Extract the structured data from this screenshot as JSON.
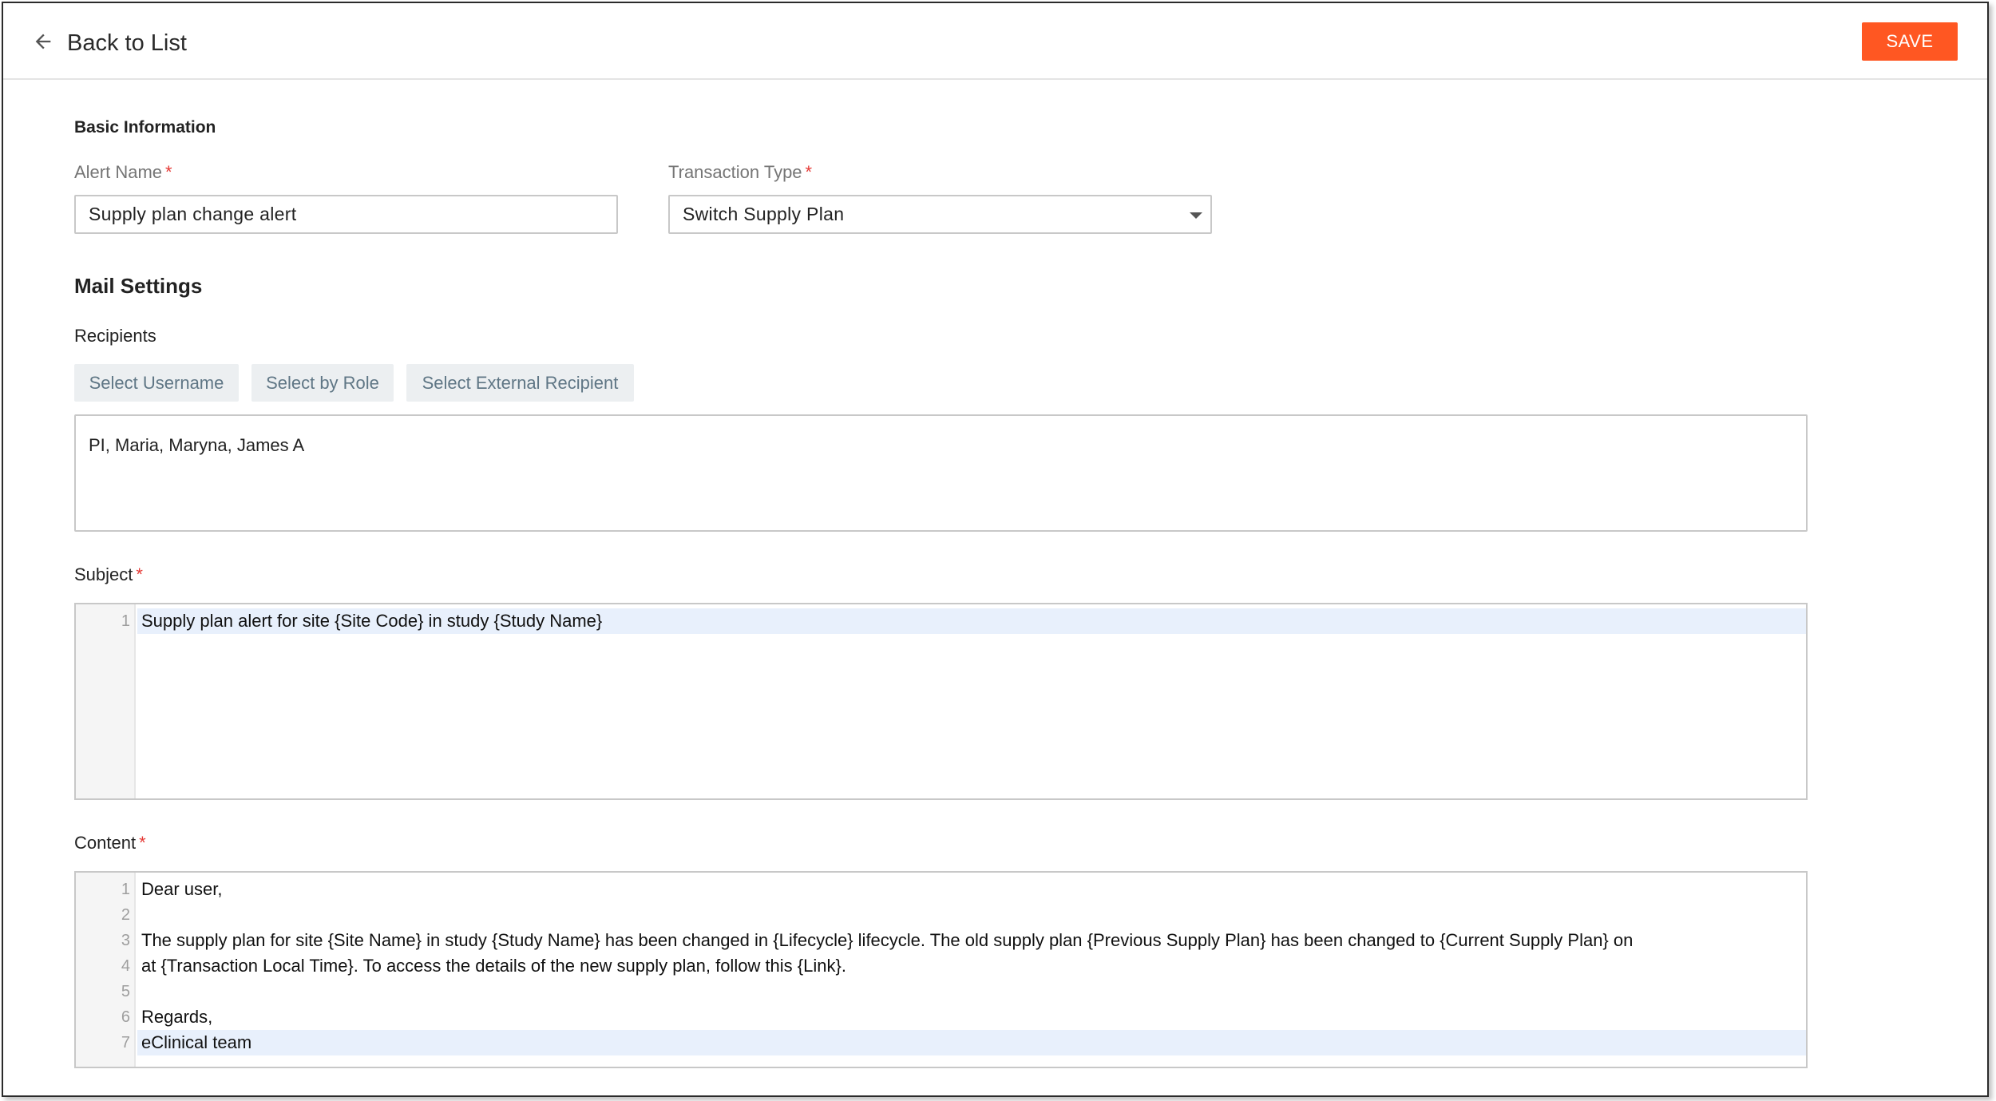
{
  "header": {
    "back_label": "Back to List",
    "save_label": "SAVE"
  },
  "basic": {
    "title": "Basic Information",
    "alert_name_label": "Alert Name",
    "alert_name_value": "Supply plan change alert",
    "transaction_type_label": "Transaction Type",
    "transaction_type_value": "Switch Supply Plan",
    "required_mark": "*"
  },
  "mail": {
    "title": "Mail Settings",
    "recipients_label": "Recipients",
    "buttons": [
      "Select Username",
      "Select by Role",
      "Select External Recipient"
    ],
    "recipients_value": "PI,  Maria,  Maryna,  James A"
  },
  "subject": {
    "label": "Subject",
    "lines": [
      {
        "num": "1",
        "text": "Supply plan alert for site {Site Code} in study {Study Name}"
      }
    ]
  },
  "content": {
    "label": "Content",
    "lines": [
      {
        "num": "1",
        "text": "Dear user,"
      },
      {
        "num": "2",
        "text": ""
      },
      {
        "num": "3",
        "text": "The supply plan for site {Site Name} in study {Study Name} has been changed in {Lifecycle} lifecycle. The old supply plan {Previous Supply Plan} has been changed to {Current Supply Plan} on"
      },
      {
        "num": "4",
        "text": "at {Transaction Local Time}. To access the details of the new supply plan, follow this {Link}."
      },
      {
        "num": "5",
        "text": ""
      },
      {
        "num": "6",
        "text": "Regards,"
      },
      {
        "num": "7",
        "text": "eClinical team"
      }
    ]
  },
  "colors": {
    "accent": "#ff5722",
    "required": "#e53935",
    "chip_bg": "#eceff1",
    "active_line": "#e8f0fc"
  },
  "icons": {
    "back": "arrow-left-icon",
    "dropdown": "caret-down-icon"
  }
}
